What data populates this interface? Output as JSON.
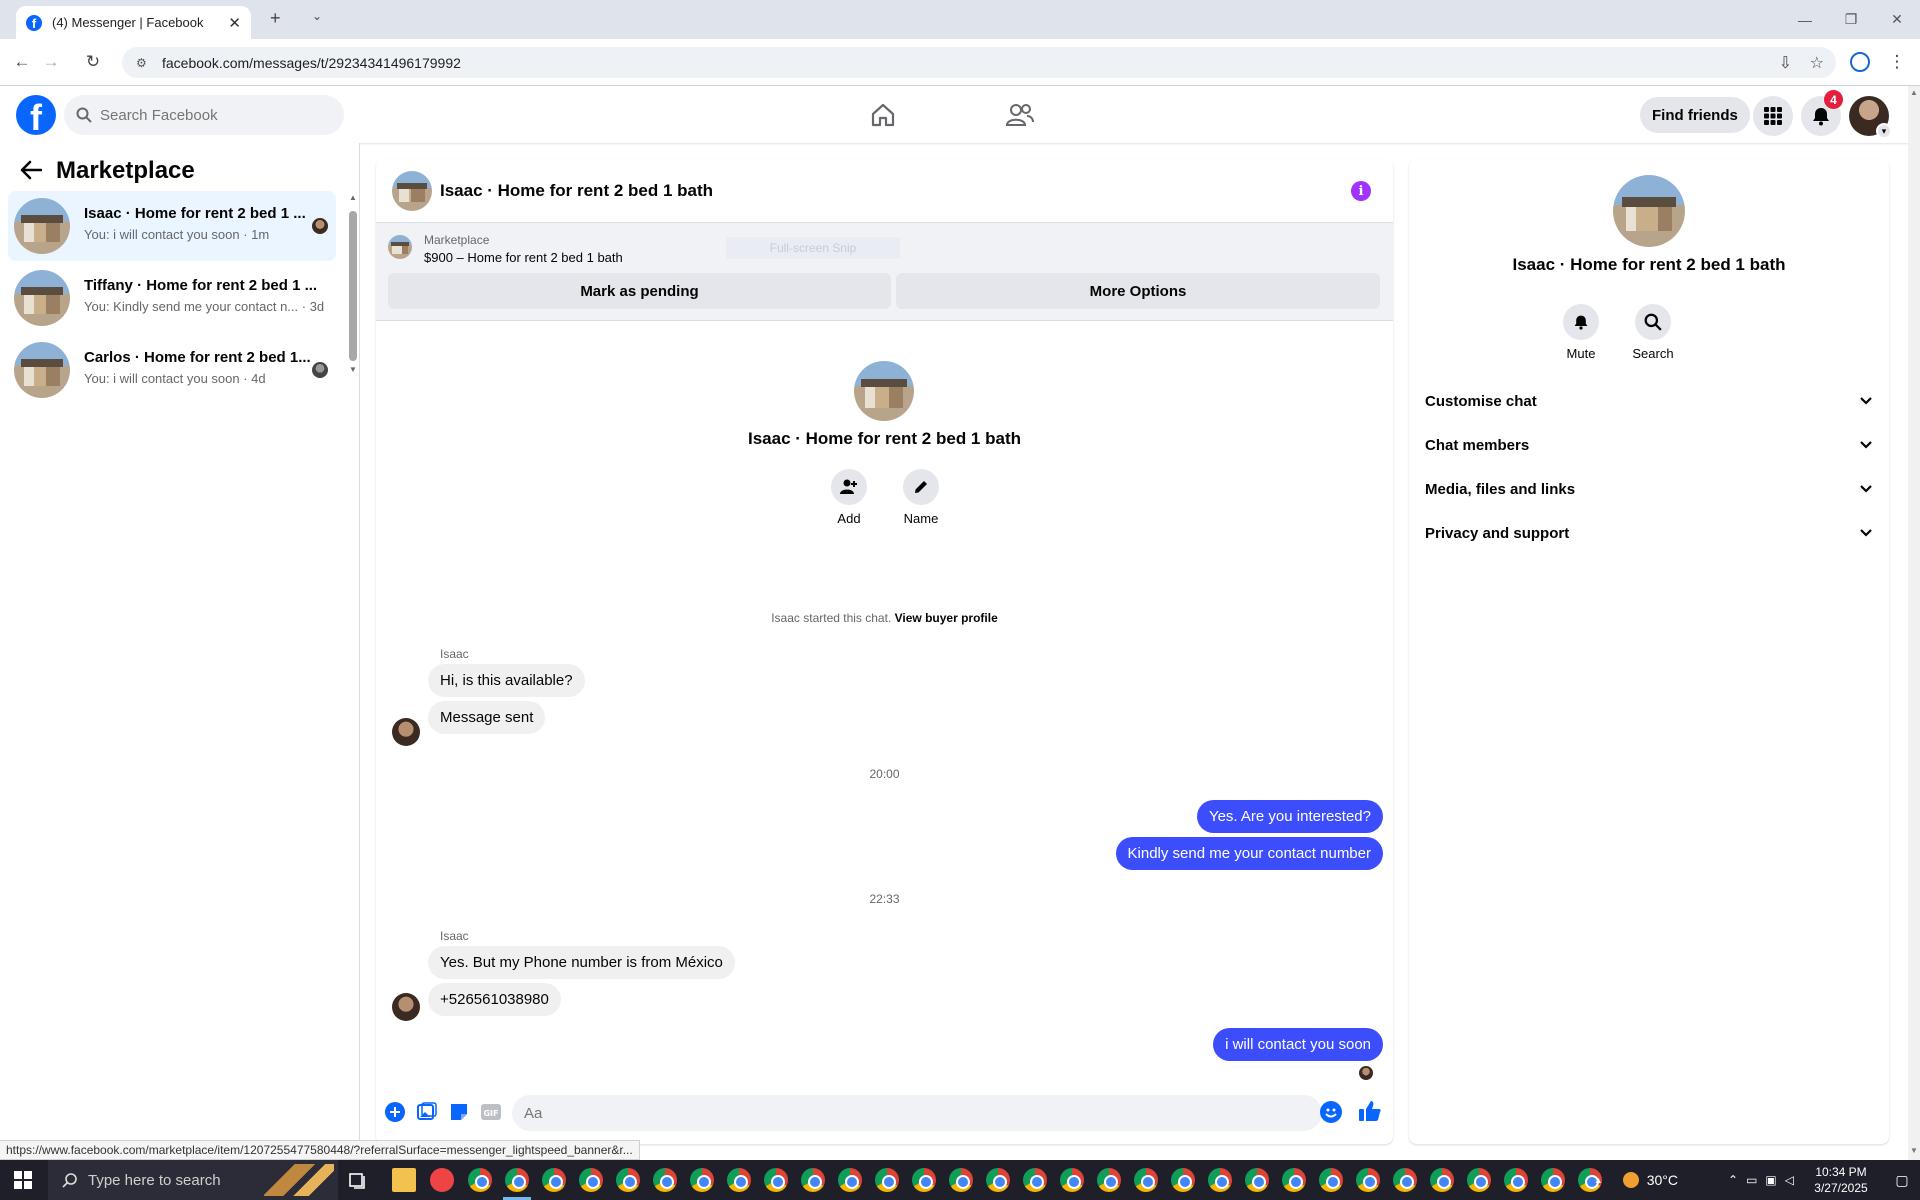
{
  "browser": {
    "tab_title": "(4) Messenger | Facebook",
    "url": "facebook.com/messages/t/29234341496179992",
    "status_url": "https://www.facebook.com/marketplace/item/1207255477580448/?referralSurface=messenger_lightspeed_banner&r..."
  },
  "header": {
    "search_placeholder": "Search Facebook",
    "find_friends": "Find friends",
    "notification_count": "4",
    "icons": [
      "facebook-logo",
      "home-icon",
      "friends-icon",
      "menu-grid-icon",
      "bell-icon"
    ]
  },
  "sidebar": {
    "title": "Marketplace",
    "chats": [
      {
        "title": "Isaac · Home for rent 2 bed 1 ...",
        "preview": "You: i will contact you soon · 1m",
        "active": true
      },
      {
        "title": "Tiffany · Home for rent 2 bed 1 ...",
        "preview": "You: Kindly send me your contact n... · 3d",
        "active": false
      },
      {
        "title": "Carlos · Home for rent 2 bed 1...",
        "preview": "You: i will contact you soon · 4d",
        "active": false
      }
    ]
  },
  "chat": {
    "title": "Isaac · Home for rent 2 bed 1 bath",
    "listing_category": "Marketplace",
    "listing_price_title": "$900 – Home for rent 2 bed 1 bath",
    "ghost_label": "Full-screen Snip",
    "mark_pending": "Mark as pending",
    "more_options": "More Options",
    "hero_title": "Isaac · Home for rent 2 bed 1 bath",
    "add_label": "Add",
    "name_label": "Name",
    "started_text": "Isaac started this chat.",
    "view_profile": "View buyer profile",
    "sender_name": "Isaac",
    "messages": {
      "m1": "Hi, is this available?",
      "m2": "Message sent",
      "time1": "20:00",
      "m3": "Yes. Are you interested?",
      "m4": "Kindly send me your contact number",
      "time2": "22:33",
      "m5": "Yes. But my Phone number is from México",
      "m6": "+526561038980",
      "m7": "i will contact you soon"
    },
    "composer_placeholder": "Aa"
  },
  "info_panel": {
    "title": "Isaac · Home for rent 2 bed 1 bath",
    "mute": "Mute",
    "search": "Search",
    "sections": [
      "Customise chat",
      "Chat members",
      "Media, files and links",
      "Privacy and support"
    ]
  },
  "taskbar": {
    "search_placeholder": "Type here to search",
    "temperature": "30°C",
    "time": "10:34 PM",
    "date": "3/27/2025"
  },
  "colors": {
    "brand": "#0866ff",
    "outgoing_bubble": "#3c4dfc",
    "info_button": "#a033ff",
    "badge": "#e41e3f"
  }
}
